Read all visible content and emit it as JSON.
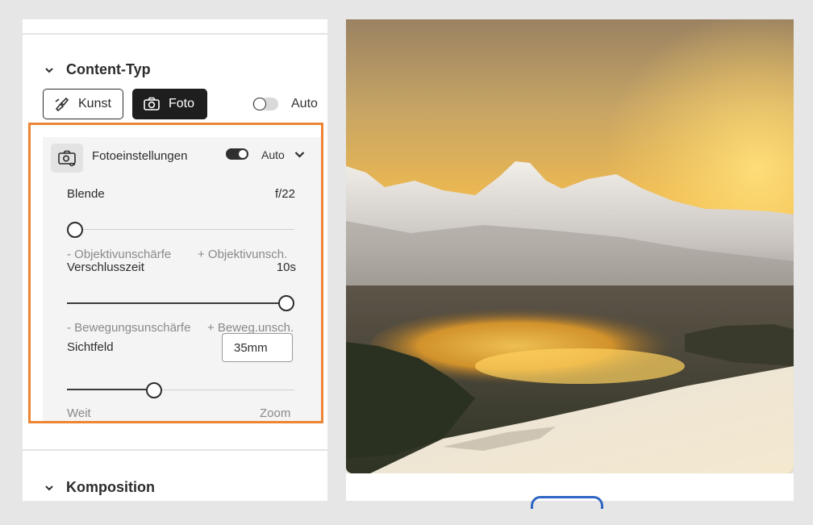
{
  "content_type": {
    "title": "Content-Typ",
    "buttons": [
      {
        "label": "Kunst",
        "icon": "brush-icon",
        "selected": false
      },
      {
        "label": "Foto",
        "icon": "camera-icon",
        "selected": true
      }
    ],
    "auto_toggle": {
      "label": "Auto",
      "on": false
    }
  },
  "photo_settings": {
    "title": "Fotoeinstellungen",
    "auto_toggle": {
      "label": "Auto",
      "on": true
    },
    "aperture": {
      "label": "Blende",
      "value": "f/22",
      "level": 0.0,
      "hint_left": "- Objektivunschärfe",
      "hint_right": "+ Objektivunsch."
    },
    "shutter": {
      "label": "Verschlusszeit",
      "value": "10s",
      "level": 1.0,
      "hint_left": "- Bewegungsunschärfe",
      "hint_right": "+ Beweg.unsch."
    },
    "field_of_view": {
      "label": "Sichtfeld",
      "value": "35mm",
      "level": 0.38,
      "hint_left": "Weit",
      "hint_right": "Zoom"
    }
  },
  "composition": {
    "title": "Komposition"
  },
  "colors": {
    "accent": "#EC8535",
    "dark": "#1E1E1E",
    "link_blue": "#2F66C4"
  }
}
